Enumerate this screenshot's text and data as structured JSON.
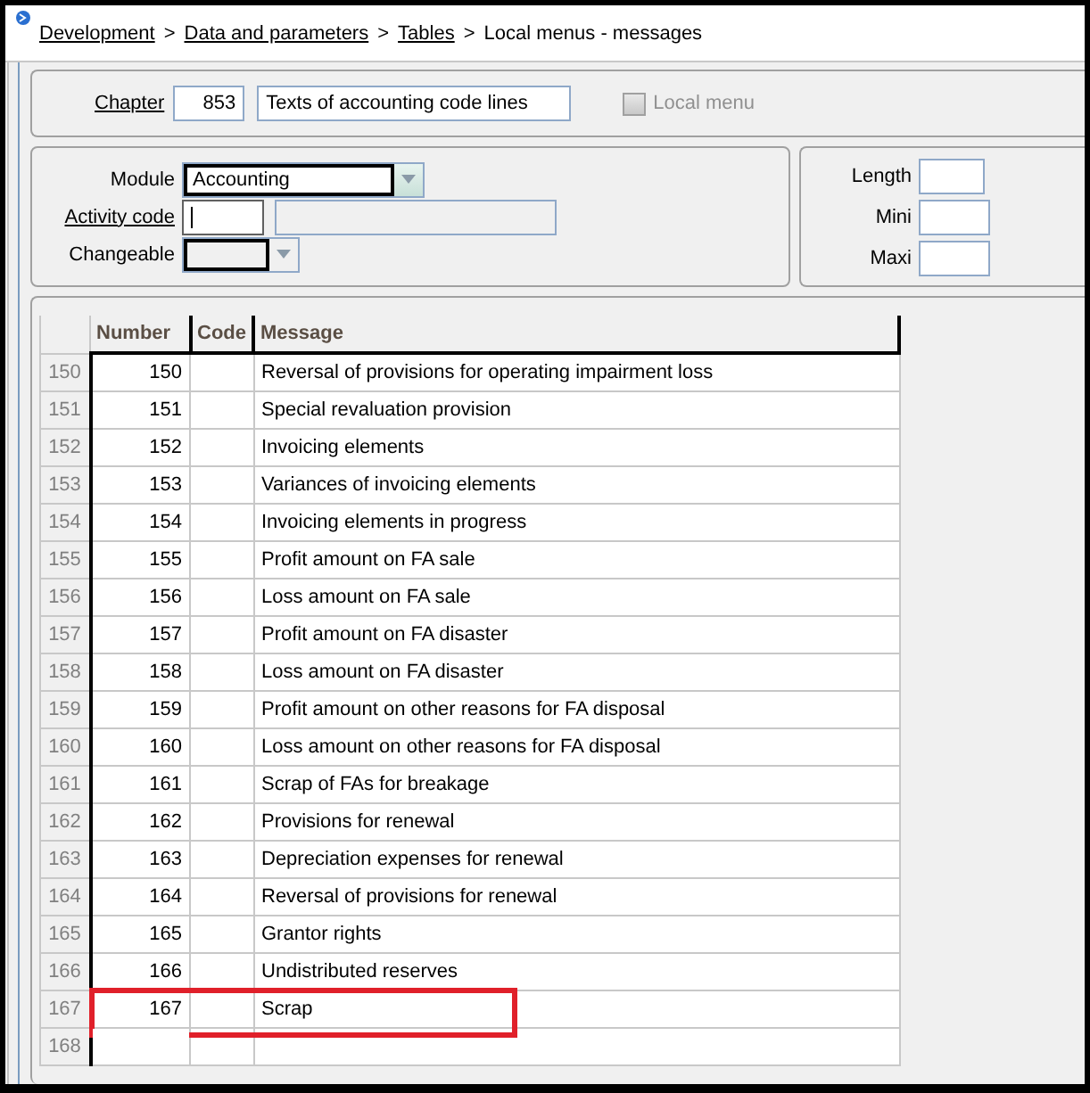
{
  "breadcrumb": [
    {
      "label": "Development",
      "link": true
    },
    {
      "label": "Data and parameters",
      "link": true
    },
    {
      "label": "Tables",
      "link": true
    },
    {
      "label": "Local menus - messages",
      "link": false
    }
  ],
  "separator": ">",
  "chapter": {
    "label": "Chapter",
    "number": "853",
    "title": "Texts of accounting code lines",
    "local_menu": {
      "label": "Local menu",
      "checked": false,
      "disabled": true
    }
  },
  "module": {
    "label": "Module",
    "value": "Accounting"
  },
  "activity_code": {
    "label": "Activity code",
    "focused": true
  },
  "changeable": {
    "label": "Changeable"
  },
  "limits": [
    {
      "label": "Length"
    },
    {
      "label": "Mini"
    },
    {
      "label": "Maxi"
    }
  ],
  "table": {
    "columns": [
      "Number",
      "Code",
      "Message"
    ],
    "rows": [
      {
        "index": "150",
        "number": "150",
        "message": "Reversal of provisions for operating impairment loss",
        "highlighted": false
      },
      {
        "index": "151",
        "number": "151",
        "message": "Special revaluation provision",
        "highlighted": false
      },
      {
        "index": "152",
        "number": "152",
        "message": "Invoicing elements",
        "highlighted": false
      },
      {
        "index": "153",
        "number": "153",
        "message": "Variances of invoicing elements",
        "highlighted": false
      },
      {
        "index": "154",
        "number": "154",
        "message": "Invoicing elements in progress",
        "highlighted": false
      },
      {
        "index": "155",
        "number": "155",
        "message": "Profit amount on FA sale",
        "highlighted": false
      },
      {
        "index": "156",
        "number": "156",
        "message": "Loss amount on  FA sale",
        "highlighted": false
      },
      {
        "index": "157",
        "number": "157",
        "message": "Profit amount on FA disaster",
        "highlighted": false
      },
      {
        "index": "158",
        "number": "158",
        "message": "Loss amount on FA disaster",
        "highlighted": false
      },
      {
        "index": "159",
        "number": "159",
        "message": "Profit amount on other reasons for FA disposal",
        "highlighted": false
      },
      {
        "index": "160",
        "number": "160",
        "message": "Loss amount on other reasons for FA disposal",
        "highlighted": false
      },
      {
        "index": "161",
        "number": "161",
        "message": "Scrap of FAs for breakage",
        "highlighted": false
      },
      {
        "index": "162",
        "number": "162",
        "message": "Provisions for renewal",
        "highlighted": false
      },
      {
        "index": "163",
        "number": "163",
        "message": "Depreciation expenses for renewal",
        "highlighted": false
      },
      {
        "index": "164",
        "number": "164",
        "message": "Reversal of provisions for renewal",
        "highlighted": false
      },
      {
        "index": "165",
        "number": "165",
        "message": "Grantor rights",
        "highlighted": false
      },
      {
        "index": "166",
        "number": "166",
        "message": "Undistributed reserves",
        "highlighted": false
      },
      {
        "index": "167",
        "number": "167",
        "message": "Scrap",
        "highlighted": true
      },
      {
        "index": "168",
        "highlighted": false
      }
    ]
  }
}
